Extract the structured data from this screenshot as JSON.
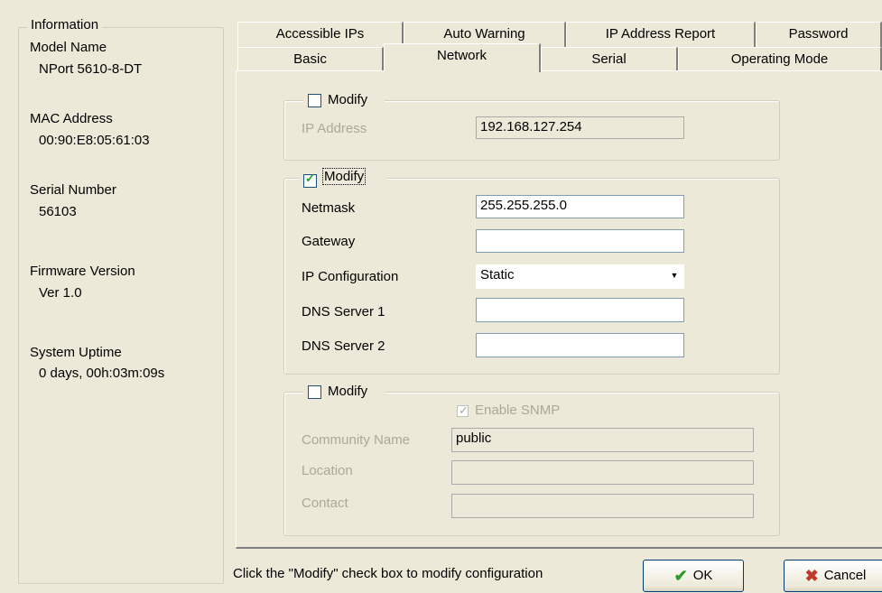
{
  "info": {
    "legend": "Information",
    "model_label": "Model Name",
    "model_value": "NPort 5610-8-DT",
    "mac_label": "MAC Address",
    "mac_value": "00:90:E8:05:61:03",
    "serial_label": "Serial Number",
    "serial_value": "56103",
    "firmware_label": "Firmware Version",
    "firmware_value": "Ver 1.0",
    "uptime_label": "System Uptime",
    "uptime_value": "0 days, 00h:03m:09s"
  },
  "tabs": {
    "row1": [
      "Accessible IPs",
      "Auto Warning",
      "IP Address Report",
      "Password"
    ],
    "row2": [
      "Basic",
      "Network",
      "Serial",
      "Operating Mode"
    ],
    "active": "Network"
  },
  "ip_group": {
    "modify_label": "Modify",
    "modify_checked": false,
    "ip_label": "IP Address",
    "ip_value": "192.168.127.254"
  },
  "net_group": {
    "modify_label": "Modify",
    "modify_checked": true,
    "netmask_label": "Netmask",
    "netmask_value": "255.255.255.0",
    "gateway_label": "Gateway",
    "gateway_value": "",
    "ipconfig_label": "IP Configuration",
    "ipconfig_value": "Static",
    "dns1_label": "DNS Server 1",
    "dns1_value": "",
    "dns2_label": "DNS Server 2",
    "dns2_value": ""
  },
  "snmp_group": {
    "modify_label": "Modify",
    "modify_checked": false,
    "enable_label": "Enable SNMP",
    "enable_checked": true,
    "community_label": "Community Name",
    "community_value": "public",
    "location_label": "Location",
    "location_value": "",
    "contact_label": "Contact",
    "contact_value": ""
  },
  "status": {
    "hint": "Click the \"Modify\" check box to modify configuration"
  },
  "buttons": {
    "ok_label": "OK",
    "cancel_label": "Cancel",
    "ok_icon": "checkmark-icon",
    "cancel_icon": "x-icon",
    "ok_icon_color": "#2e9a2e",
    "cancel_icon_color": "#c0392b"
  }
}
